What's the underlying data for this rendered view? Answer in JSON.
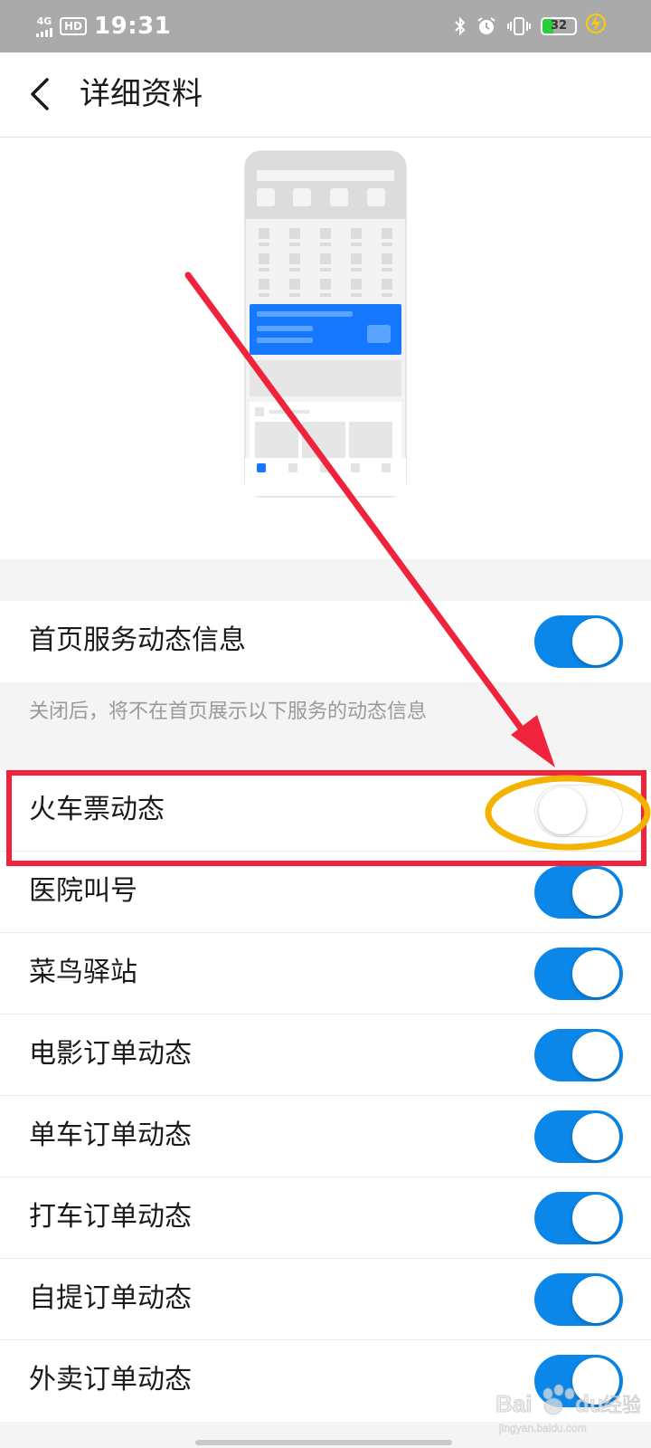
{
  "status_bar": {
    "network": "4G",
    "hd": "HD",
    "time": "19:31",
    "battery_level": 32,
    "battery_label": "32",
    "icons": [
      "bluetooth-icon",
      "alarm-icon",
      "vibrate-icon",
      "battery-icon",
      "charging-icon"
    ]
  },
  "header": {
    "title": "详细资料",
    "back_icon": "chevron-left-icon"
  },
  "main_toggle": {
    "label": "首页服务动态信息",
    "on": true
  },
  "hint": "关闭后，将不在首页展示以下服务的动态信息",
  "services": [
    {
      "label": "火车票动态",
      "on": false
    },
    {
      "label": "医院叫号",
      "on": true
    },
    {
      "label": "菜鸟驿站",
      "on": true
    },
    {
      "label": "电影订单动态",
      "on": true
    },
    {
      "label": "单车订单动态",
      "on": true
    },
    {
      "label": "打车订单动态",
      "on": true
    },
    {
      "label": "自提订单动态",
      "on": true
    },
    {
      "label": "外卖订单动态",
      "on": true
    }
  ],
  "colors": {
    "toggle_on": "#0a87e9",
    "annotation_red": "#f0233c",
    "annotation_orange": "#f5b301",
    "illustration_blue": "#1677ff"
  },
  "watermark": {
    "brand": "Bai du 经验",
    "domain": "jingyan.baidu.com"
  }
}
